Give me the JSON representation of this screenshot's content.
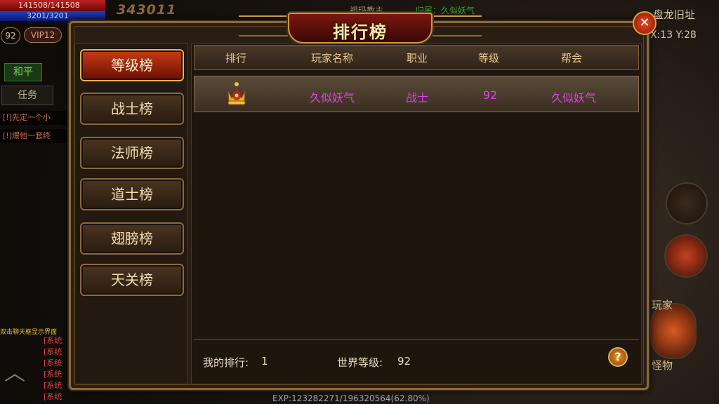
{
  "hud": {
    "hp": "141508/141508",
    "mp": "3201/3201",
    "power": "343011",
    "level": "92",
    "vip": "VIP12",
    "mode": "和平",
    "task_tab": "任务",
    "quests": [
      "[!]先定一个小",
      "[!]爆他一套终"
    ],
    "chat_hint": "双击聊天框显示界面",
    "chat_lines": [
      "[系统",
      "[系统",
      "[系统",
      "[系统",
      "[系统",
      "[系统"
    ],
    "top_boss": "祖玛教主",
    "top_owner": "归属：久似妖气",
    "map_name": "盘龙旧址",
    "coords": "X:13 Y:28",
    "side_label_1": "玩家",
    "side_label_2": "怪物",
    "exp": "EXP:123282271/196320564(62.80%)"
  },
  "panel": {
    "title": "排行榜",
    "close_icon": "close-x-icon",
    "categories": [
      {
        "label": "等级榜",
        "active": true
      },
      {
        "label": "战士榜",
        "active": false
      },
      {
        "label": "法师榜",
        "active": false
      },
      {
        "label": "道士榜",
        "active": false
      },
      {
        "label": "翅膀榜",
        "active": false
      },
      {
        "label": "天关榜",
        "active": false
      }
    ],
    "columns": [
      "排行",
      "玩家名称",
      "职业",
      "等级",
      "帮会"
    ],
    "rows": [
      {
        "rank_icon": "crown-icon",
        "name": "久似妖气",
        "class": "战士",
        "level": "92",
        "guild": "久似妖气"
      }
    ],
    "my_rank_label": "我的排行:",
    "my_rank_value": "1",
    "world_level_label": "世界等级:",
    "world_level_value": "92",
    "help_icon": "?",
    "colors": {
      "player_text": "#e040e8",
      "accent_gold": "#c89a40",
      "active_tab": "#c83a18"
    }
  }
}
